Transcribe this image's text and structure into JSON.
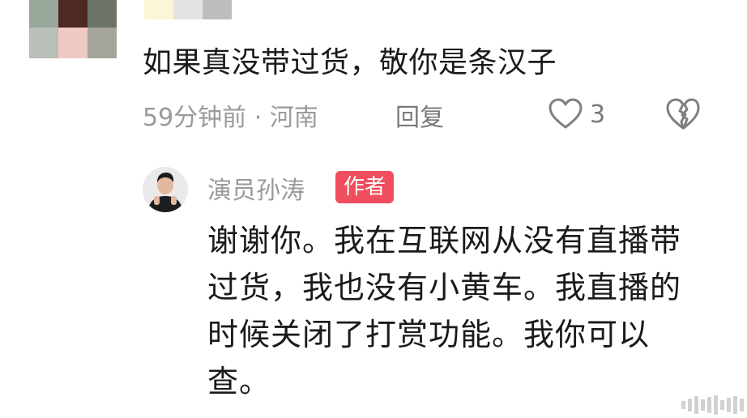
{
  "top_comment": {
    "text": "如果真没带过货，敬你是条汉子",
    "time_location": "59分钟前 · 河南",
    "reply_label": "回复",
    "like_count": "3"
  },
  "author_reply": {
    "name": "演员孙涛",
    "badge": "作者",
    "text": "谢谢你。我在互联网从没有直播带过货，我也没有小黄车。我直播的时候关闭了打赏功能。我你可以查。"
  },
  "colors": {
    "badge_bg": "#f04d5e",
    "meta_gray": "#9a9a9a",
    "text_dark": "#1a1a1a"
  },
  "icons": {
    "like": "heart-outline-icon",
    "dislike": "broken-heart-icon"
  }
}
